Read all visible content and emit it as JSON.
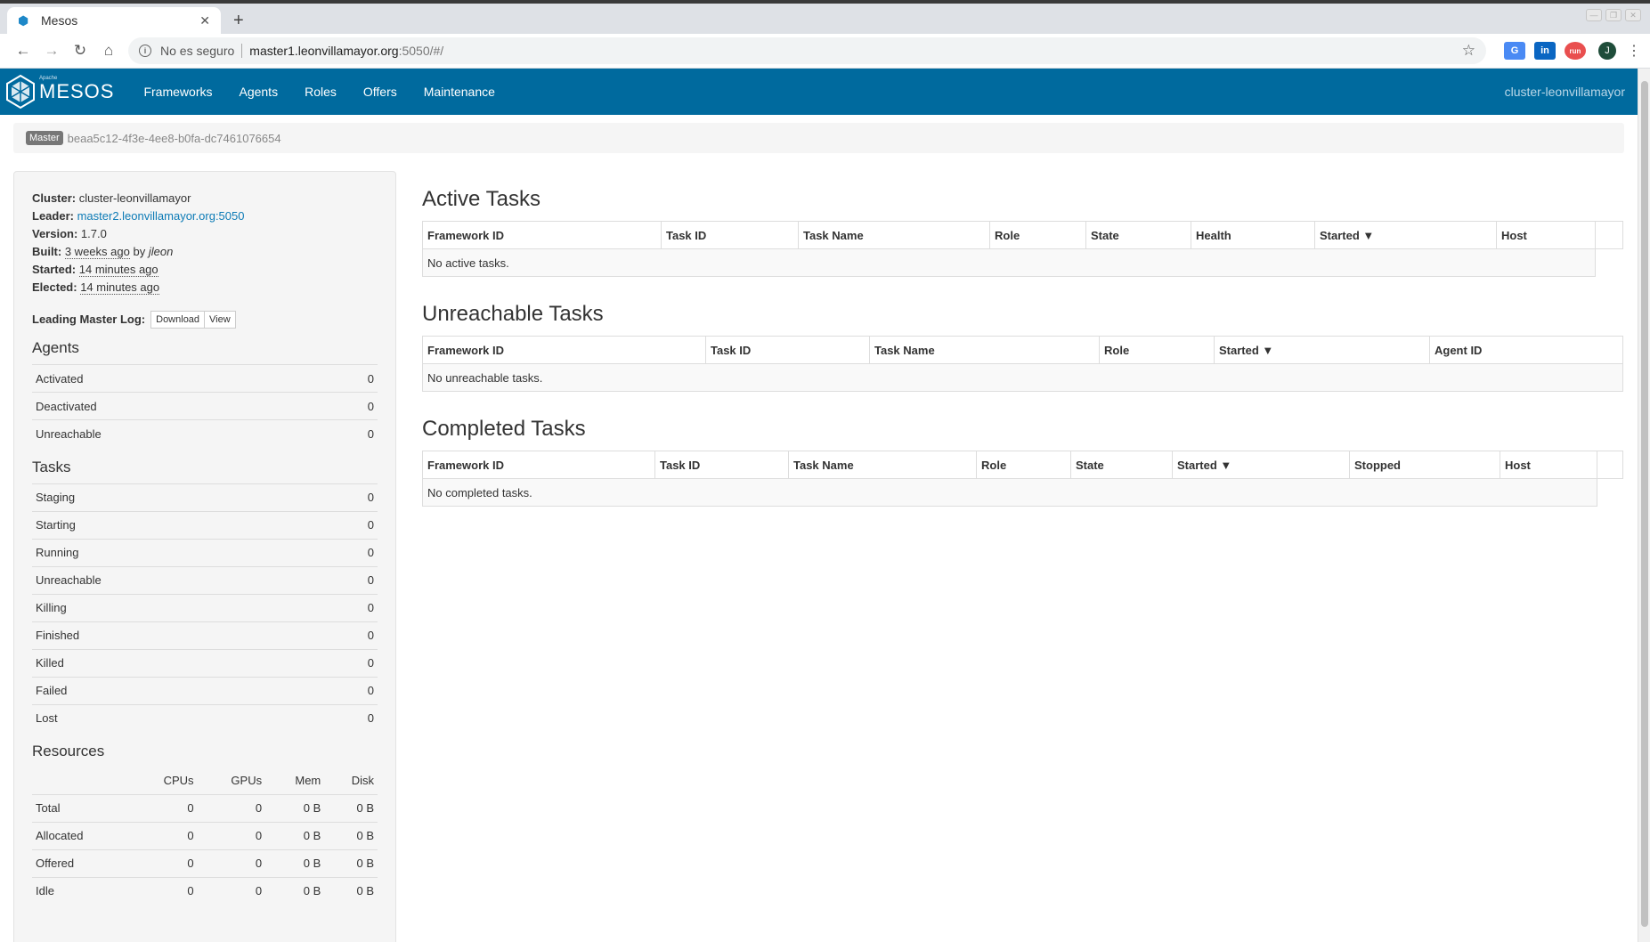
{
  "browser": {
    "tab_title": "Mesos",
    "not_secure": "No es seguro",
    "url_host": "master1.leonvillamayor.org",
    "url_rest": ":5050/#/",
    "profile_initial": "J"
  },
  "navbar": {
    "brand_small": "Apache",
    "brand": "MESOS",
    "links": [
      "Frameworks",
      "Agents",
      "Roles",
      "Offers",
      "Maintenance"
    ],
    "cluster": "cluster-leonvillamayor"
  },
  "breadcrumb": {
    "label": "Master",
    "id": "beaa5c12-4f3e-4ee8-b0fa-dc7461076654"
  },
  "info": {
    "cluster_label": "Cluster:",
    "cluster": "cluster-leonvillamayor",
    "leader_label": "Leader:",
    "leader": "master2.leonvillamayor.org:5050",
    "version_label": "Version:",
    "version": "1.7.0",
    "built_label": "Built:",
    "built_ago": "3 weeks ago",
    "built_by": "by",
    "built_user": "jleon",
    "started_label": "Started:",
    "started": "14 minutes ago",
    "elected_label": "Elected:",
    "elected": "14 minutes ago",
    "log_label": "Leading Master Log:",
    "download": "Download",
    "view": "View"
  },
  "agents": {
    "title": "Agents",
    "rows": [
      {
        "label": "Activated",
        "value": "0"
      },
      {
        "label": "Deactivated",
        "value": "0"
      },
      {
        "label": "Unreachable",
        "value": "0"
      }
    ]
  },
  "tasks": {
    "title": "Tasks",
    "rows": [
      {
        "label": "Staging",
        "value": "0"
      },
      {
        "label": "Starting",
        "value": "0"
      },
      {
        "label": "Running",
        "value": "0"
      },
      {
        "label": "Unreachable",
        "value": "0"
      },
      {
        "label": "Killing",
        "value": "0"
      },
      {
        "label": "Finished",
        "value": "0"
      },
      {
        "label": "Killed",
        "value": "0"
      },
      {
        "label": "Failed",
        "value": "0"
      },
      {
        "label": "Lost",
        "value": "0"
      }
    ]
  },
  "resources": {
    "title": "Resources",
    "headers": [
      "CPUs",
      "GPUs",
      "Mem",
      "Disk"
    ],
    "rows": [
      {
        "label": "Total",
        "cpus": "0",
        "gpus": "0",
        "mem": "0 B",
        "disk": "0 B"
      },
      {
        "label": "Allocated",
        "cpus": "0",
        "gpus": "0",
        "mem": "0 B",
        "disk": "0 B"
      },
      {
        "label": "Offered",
        "cpus": "0",
        "gpus": "0",
        "mem": "0 B",
        "disk": "0 B"
      },
      {
        "label": "Idle",
        "cpus": "0",
        "gpus": "0",
        "mem": "0 B",
        "disk": "0 B"
      }
    ]
  },
  "active": {
    "title": "Active Tasks",
    "columns": [
      "Framework ID",
      "Task ID",
      "Task Name",
      "Role",
      "State",
      "Health",
      "Started ▼",
      "Host"
    ],
    "empty": "No active tasks."
  },
  "unreachable": {
    "title": "Unreachable Tasks",
    "columns": [
      "Framework ID",
      "Task ID",
      "Task Name",
      "Role",
      "Started ▼",
      "Agent ID"
    ],
    "empty": "No unreachable tasks."
  },
  "completed": {
    "title": "Completed Tasks",
    "columns": [
      "Framework ID",
      "Task ID",
      "Task Name",
      "Role",
      "State",
      "Started ▼",
      "Stopped",
      "Host"
    ],
    "empty": "No completed tasks."
  }
}
